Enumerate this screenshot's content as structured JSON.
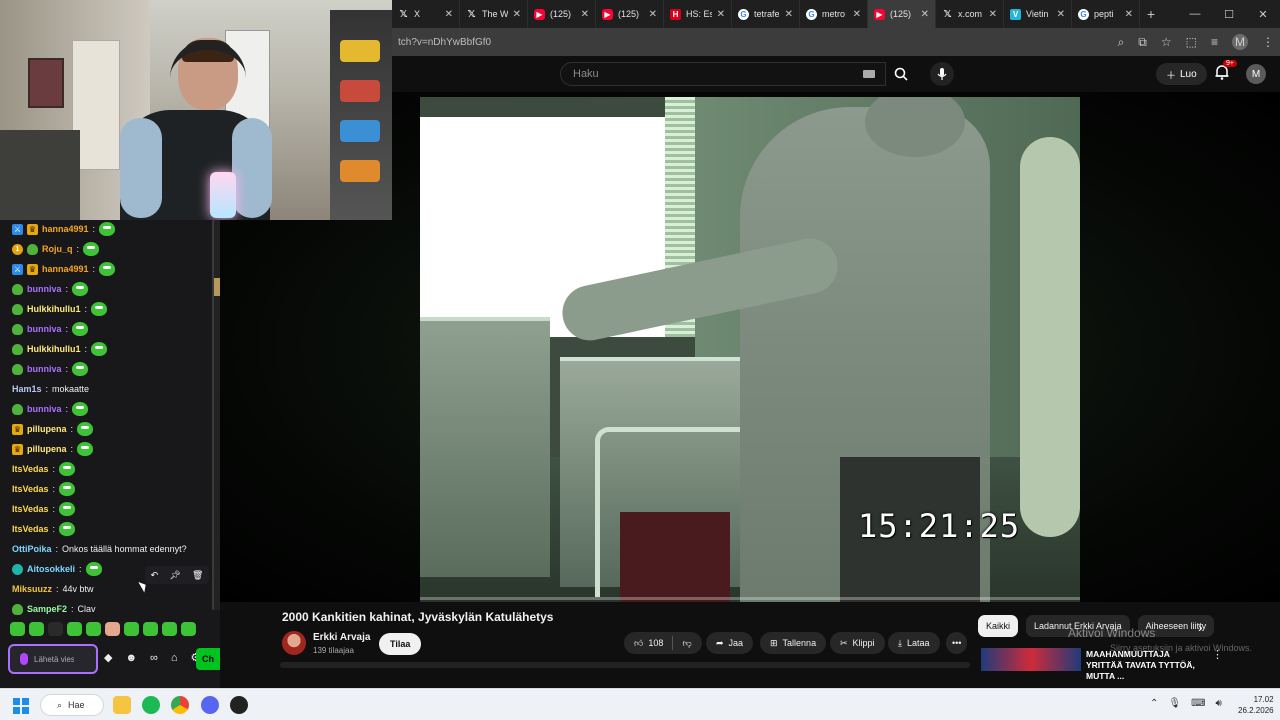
{
  "browser": {
    "tabs": [
      {
        "icon": "x-logo-icon",
        "label": "X"
      },
      {
        "icon": "x-logo-icon",
        "label": "The W"
      },
      {
        "icon": "youtube-icon",
        "label": "(125)"
      },
      {
        "icon": "youtube-icon",
        "label": "(125)"
      },
      {
        "icon": "hs-icon",
        "label": "HS: Es"
      },
      {
        "icon": "google-icon",
        "label": "tetrafe"
      },
      {
        "icon": "google-icon",
        "label": "metro"
      },
      {
        "icon": "youtube-icon",
        "label": "(125)"
      },
      {
        "icon": "x-logo-icon",
        "label": "x.com"
      },
      {
        "icon": "vietin-icon",
        "label": "Vietin"
      },
      {
        "icon": "google-icon",
        "label": "pepti"
      }
    ],
    "url": "tch?v=nDhYwBbfGf0",
    "profile_initial": "M"
  },
  "youtube": {
    "search_placeholder": "Haku",
    "create_label": "Luo",
    "notifications_count": "9+",
    "avatar_initial": "M",
    "video": {
      "timestamp_overlay": "15:21:25",
      "title": "2000 Kankitien kahinat, Jyväskylän Katulähetys",
      "channel": "Erkki Arvaja",
      "subscribers": "139 tilaajaa",
      "subscribe_label": "Tilaa",
      "likes": "108",
      "share_label": "Jaa",
      "save_label": "Tallenna",
      "clip_label": "Klippi",
      "download_label": "Lataa"
    },
    "chips": [
      "Kaikki",
      "Ladannut Erkki Arvaja",
      "Aiheeseen liitty"
    ],
    "recommendation": {
      "title": "MAAHANMUUTTAJA YRITTÄÄ TAVATA TYTTÖÄ, MUTTA ..."
    },
    "windows_watermark": {
      "line1": "Aktivoi Windows",
      "line2": "Siirry asetuksiin ja aktivoi Windows."
    }
  },
  "chat": {
    "messages": [
      {
        "user": "hanna4991",
        "color": "#f5a623",
        "badges": [
          "blue",
          "crown"
        ],
        "text": ""
      },
      {
        "user": "Roju_q",
        "color": "#f5a623",
        "badges": [
          "num",
          "frog"
        ],
        "text": ""
      },
      {
        "user": "hanna4991",
        "color": "#f5a623",
        "badges": [
          "blue",
          "crown"
        ],
        "text": ""
      },
      {
        "user": "bunniva",
        "color": "#a970ff",
        "badges": [
          "frog"
        ],
        "text": ""
      },
      {
        "user": "Hulkkihullu1",
        "color": "#ffe97a",
        "badges": [
          "frog"
        ],
        "text": ""
      },
      {
        "user": "bunniva",
        "color": "#a970ff",
        "badges": [
          "frog"
        ],
        "text": ""
      },
      {
        "user": "Hulkkihullu1",
        "color": "#ffe97a",
        "badges": [
          "frog"
        ],
        "text": ""
      },
      {
        "user": "bunniva",
        "color": "#a970ff",
        "badges": [
          "frog"
        ],
        "text": ""
      },
      {
        "user": "Ham1s",
        "color": "#b9c7f6",
        "badges": [],
        "text": "mokaatte"
      },
      {
        "user": "bunniva",
        "color": "#a970ff",
        "badges": [
          "frog"
        ],
        "text": ""
      },
      {
        "user": "pillupena",
        "color": "#ffe97a",
        "badges": [
          "crown"
        ],
        "text": ""
      },
      {
        "user": "pillupena",
        "color": "#ffe97a",
        "badges": [
          "crown"
        ],
        "text": ""
      },
      {
        "user": "ItsVedas",
        "color": "#ffd84a",
        "badges": [],
        "text": ""
      },
      {
        "user": "ItsVedas",
        "color": "#ffd84a",
        "badges": [],
        "text": ""
      },
      {
        "user": "ItsVedas",
        "color": "#ffd84a",
        "badges": [],
        "text": ""
      },
      {
        "user": "ItsVedas",
        "color": "#ffd84a",
        "badges": [],
        "text": ""
      },
      {
        "user": "OttiPoika",
        "color": "#7fd6ff",
        "badges": [],
        "text": "Onkos täällä hommat edennyt?"
      },
      {
        "user": "Aitosokkeli",
        "color": "#7fd6ff",
        "badges": [
          "teal"
        ],
        "text": ""
      },
      {
        "user": "Miksuuzz",
        "color": "#f5c542",
        "badges": [],
        "text": "44v btw"
      },
      {
        "user": "SampeF2",
        "color": "#9af7a1",
        "badges": [
          "frog"
        ],
        "text": "Clav"
      }
    ],
    "input_placeholder": "Lähetä viesti",
    "chat_button_label": "Ch"
  },
  "taskbar": {
    "search_label": "Hae",
    "time": "17.02",
    "date": "26.2.2026"
  },
  "colors": {
    "youtube_red": "#ff0033",
    "twitch_purple": "#a970ff",
    "chat_green": "#00c41e"
  }
}
